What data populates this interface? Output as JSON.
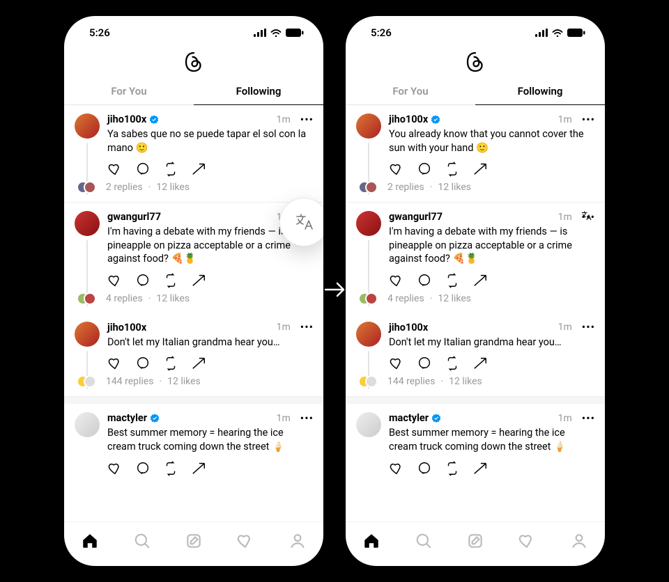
{
  "status": {
    "time": "5:26"
  },
  "tabs": {
    "for_you": "For You",
    "following": "Following"
  },
  "posts": [
    {
      "user": "jiho100x",
      "verified": true,
      "time": "1m",
      "body_left": "Ya sabes que no se puede tapar el sol con la mano 🙂",
      "body_right": "You already know that you cannot cover the sun with your hand 🙂",
      "replies": "2 replies",
      "likes": "12 likes",
      "avatar_bg": "linear-gradient(135deg,#d73,#a22)",
      "mini1": "#668",
      "mini2": "#a55"
    },
    {
      "user": "gwangurl77",
      "verified": false,
      "time": "1m",
      "body_left": "I'm having a debate with my friends — is pineapple on pizza acceptable or a crime against food? 🍕🍍",
      "body_right": "I'm having a debate with my friends — is pineapple on pizza acceptable or a crime against food? 🍕🍍",
      "replies": "4 replies",
      "likes": "12 likes",
      "avatar_bg": "linear-gradient(135deg,#c33,#811)",
      "mini1": "#9b6",
      "mini2": "#b44"
    },
    {
      "user": "jiho100x",
      "verified": false,
      "time": "1m",
      "body_left": "Don't let my Italian grandma hear you…",
      "body_right": "Don't let my Italian grandma hear you…",
      "replies": "144 replies",
      "likes": "12 likes",
      "avatar_bg": "linear-gradient(135deg,#d73,#a22)",
      "mini1": "#fc3",
      "mini2": "#ddd"
    },
    {
      "user": "mactyler",
      "verified": true,
      "time": "1m",
      "body_left": "Best summer memory = hearing the ice cream truck coming down the street 🍦",
      "body_right": "Best summer memory = hearing the ice cream truck coming down the street 🍦",
      "replies": "",
      "likes": "",
      "avatar_bg": "linear-gradient(135deg,#eee,#ccc)"
    }
  ]
}
